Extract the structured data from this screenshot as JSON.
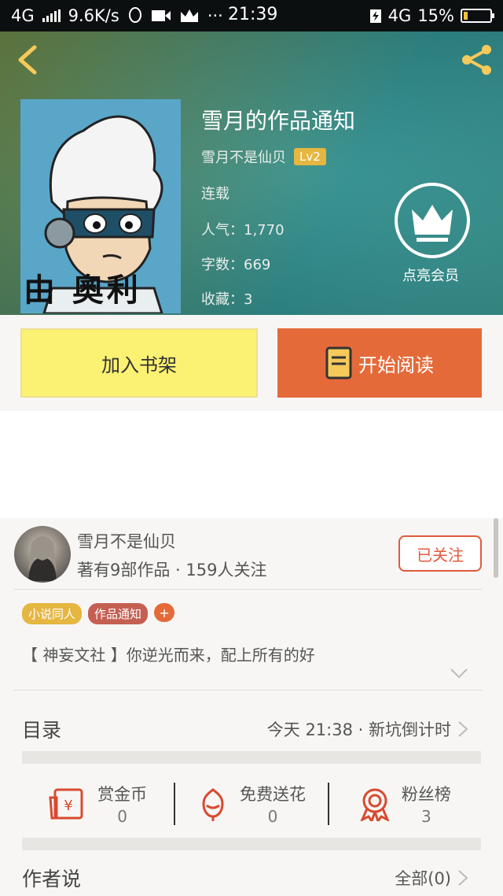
{
  "status_bar": {
    "network": "4G",
    "speed": "9.6K/s",
    "more": "···",
    "time": "21:39",
    "network_right": "4G",
    "battery_pct": "15%",
    "battery_level": 0.15
  },
  "book": {
    "title": "雪月的作品通知",
    "author": "雪月不是仙贝",
    "level": "Lv2",
    "status": "连载",
    "popularity": "人气：1,770",
    "word_count": "字数：669",
    "favorites": "收藏：3",
    "cover_text": "由 奧利",
    "vip_label": "点亮会员"
  },
  "actions": {
    "add_shelf": "加入书架",
    "start_read": "开始阅读"
  },
  "author_card": {
    "name": "雪月不是仙贝",
    "stats": "著有9部作品 · 159人关注",
    "follow": "已关注"
  },
  "tags": [
    "小说同人",
    "作品通知",
    "+"
  ],
  "description": "【 神妄文社 】你逆光而来，配上所有的好",
  "toc": {
    "label": "目录",
    "update": "今天 21:38 · 新坑倒计时"
  },
  "stats": [
    {
      "label": "赏金币",
      "value": "0"
    },
    {
      "label": "免费送花",
      "value": "0"
    },
    {
      "label": "粉丝榜",
      "value": "3"
    }
  ],
  "author_says": {
    "label": "作者说",
    "all": "全部(0)"
  },
  "colors": {
    "accent": "#e56a3a",
    "shelf": "#fbf173",
    "follow": "#e05a3c",
    "level_badge": "#e5b640"
  }
}
